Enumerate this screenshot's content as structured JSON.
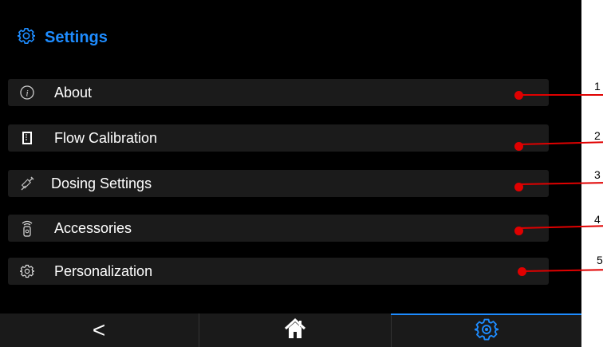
{
  "header": {
    "title": "Settings",
    "icon": "gear-icon"
  },
  "menu": {
    "items": [
      {
        "label": "About",
        "icon": "info-icon",
        "callout": "1"
      },
      {
        "label": "Flow Calibration",
        "icon": "beaker-icon",
        "callout": "2"
      },
      {
        "label": "Dosing Settings",
        "icon": "dosing-syringe-icon",
        "callout": "3"
      },
      {
        "label": "Accessories",
        "icon": "remote-control-icon",
        "callout": "4"
      },
      {
        "label": "Personalization",
        "icon": "gear-icon",
        "callout": "5"
      }
    ]
  },
  "footer": {
    "back_label": "<",
    "home_icon": "home-icon",
    "settings_icon": "gear-icon"
  },
  "colors": {
    "accent": "#1e8cff",
    "row_bg": "#1b1b1b",
    "callout": "#e00000",
    "screen_bg": "#000000"
  }
}
